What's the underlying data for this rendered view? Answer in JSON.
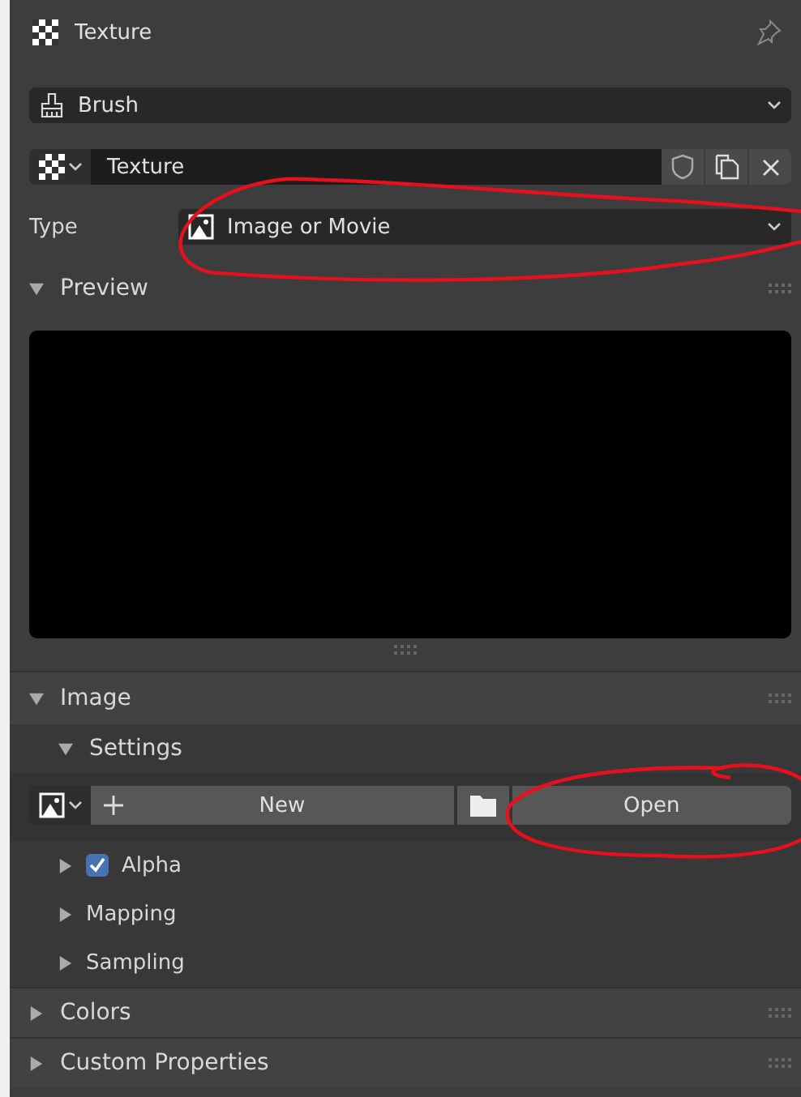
{
  "header": {
    "title": "Texture",
    "pinned": false
  },
  "brush_select": {
    "value": "Brush"
  },
  "texture_select": {
    "value": "Texture"
  },
  "type_field": {
    "label": "Type",
    "value": "Image or Movie",
    "circled": true
  },
  "preview": {
    "title": "Preview",
    "expanded": true
  },
  "image": {
    "title": "Image",
    "expanded": true,
    "settings": {
      "title": "Settings",
      "expanded": true
    },
    "buttons": [
      {
        "kind": "new",
        "label": "New",
        "circled": false
      },
      {
        "kind": "open",
        "label": "Open",
        "circled": true
      }
    ],
    "subpanels": [
      {
        "title": "Alpha",
        "expanded": false,
        "checkbox": true,
        "checked": true
      },
      {
        "title": "Mapping",
        "expanded": false
      },
      {
        "title": "Sampling",
        "expanded": false
      }
    ]
  },
  "panels": [
    {
      "title": "Colors",
      "expanded": false
    },
    {
      "title": "Custom Properties",
      "expanded": false
    }
  ]
}
